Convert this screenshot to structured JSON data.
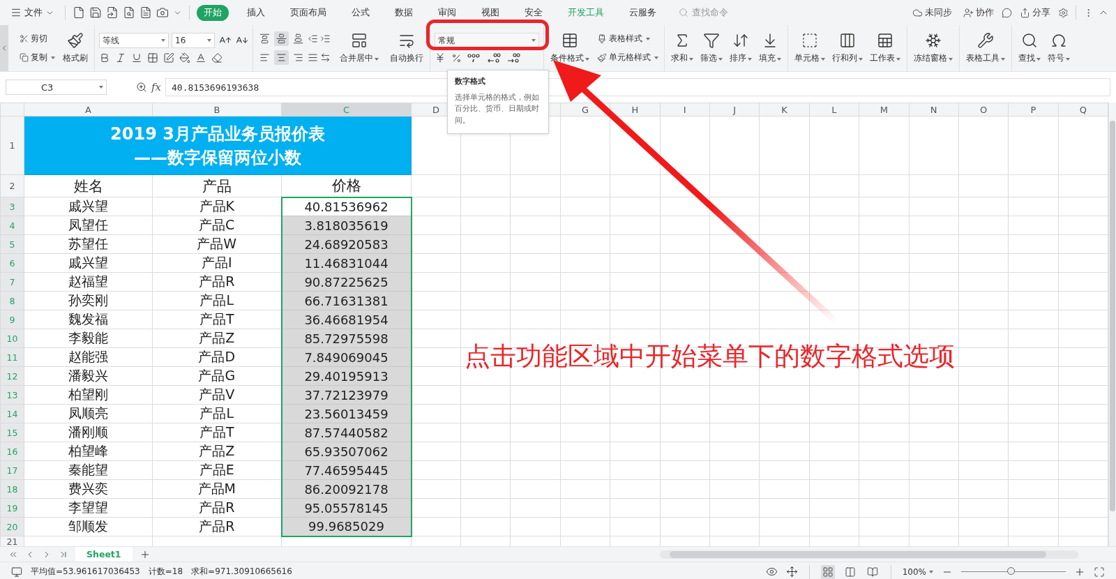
{
  "menu_bar": {
    "file_menu": "文件",
    "tabs": [
      {
        "label": "开始",
        "selected": true,
        "accent": false
      },
      {
        "label": "插入",
        "selected": false,
        "accent": false
      },
      {
        "label": "页面布局",
        "selected": false,
        "accent": false
      },
      {
        "label": "公式",
        "selected": false,
        "accent": false
      },
      {
        "label": "数据",
        "selected": false,
        "accent": false
      },
      {
        "label": "审阅",
        "selected": false,
        "accent": false
      },
      {
        "label": "视图",
        "selected": false,
        "accent": false
      },
      {
        "label": "安全",
        "selected": false,
        "accent": false
      },
      {
        "label": "开发工具",
        "selected": false,
        "accent": true
      },
      {
        "label": "云服务",
        "selected": false,
        "accent": false
      }
    ],
    "search": {
      "placeholder": "查找命令"
    },
    "actions": [
      {
        "kind": "sync",
        "label": "未同步"
      },
      {
        "kind": "collab",
        "label": "协作"
      },
      {
        "kind": "chat"
      },
      {
        "kind": "share",
        "label": "分享"
      },
      {
        "kind": "settings"
      }
    ]
  },
  "ribbon": {
    "clipboard": {
      "cut": "剪切",
      "copy": "复制",
      "painter": "格式刷"
    },
    "font": {
      "name": "等线",
      "size": "16"
    },
    "vertical_align": [
      {
        "selected": false
      },
      {
        "selected": true
      },
      {
        "selected": false
      }
    ],
    "horizontal_align": [
      {
        "selected": false
      },
      {
        "selected": true
      },
      {
        "selected": false
      }
    ],
    "merge": "合并居中",
    "wrap": "自动换行",
    "number": {
      "format": "常规"
    },
    "conditional": "条件格式",
    "table_style": "表格样式",
    "cell_style": "单元格样式",
    "groups": [
      [
        {
          "kind": "sum",
          "label": "求和"
        },
        {
          "kind": "filter",
          "label": "筛选"
        },
        {
          "kind": "sort",
          "label": "排序"
        },
        {
          "kind": "fill",
          "label": "填充"
        }
      ],
      [
        {
          "kind": "cell",
          "label": "单元格"
        },
        {
          "kind": "rowcol",
          "label": "行和列"
        },
        {
          "kind": "sheet",
          "label": "工作表"
        }
      ],
      [
        {
          "kind": "freeze",
          "label": "冻结窗格"
        }
      ],
      [
        {
          "kind": "tools",
          "label": "表格工具"
        }
      ],
      [
        {
          "kind": "find",
          "label": "查找"
        },
        {
          "kind": "symbol",
          "label": "符号"
        }
      ]
    ]
  },
  "tooltip": {
    "title": "数字格式",
    "body": "选择单元格的格式，例如百分比、货币、日期或时间。"
  },
  "formula_bar": {
    "cell_ref": "C3",
    "fx_label": "fx",
    "value": "40.8153696193638"
  },
  "sheet": {
    "columns": [
      {
        "label": "A",
        "selected": false
      },
      {
        "label": "B",
        "selected": false
      },
      {
        "label": "C",
        "selected": true
      },
      {
        "label": "D",
        "selected": false
      },
      {
        "label": "G",
        "selected": false
      },
      {
        "label": "H",
        "selected": false
      },
      {
        "label": "I",
        "selected": false
      },
      {
        "label": "J",
        "selected": false
      },
      {
        "label": "K",
        "selected": false
      },
      {
        "label": "L",
        "selected": false
      },
      {
        "label": "M",
        "selected": false
      },
      {
        "label": "N",
        "selected": false
      },
      {
        "label": "O",
        "selected": false
      },
      {
        "label": "P",
        "selected": false
      },
      {
        "label": "Q",
        "selected": false
      }
    ],
    "title_row": {
      "row": "1",
      "lines": [
        "2019 3月产品业务员报价表",
        "——数字保留两位小数"
      ]
    },
    "header_row": {
      "row": "2",
      "cells": [
        "姓名",
        "产品",
        "价格"
      ]
    },
    "rows": [
      {
        "row": "3",
        "name": "戚兴望",
        "product": "产品K",
        "price": "40.81536962",
        "selected": true,
        "active": true
      },
      {
        "row": "4",
        "name": "凤望任",
        "product": "产品C",
        "price": "3.818035619",
        "selected": true,
        "active": false
      },
      {
        "row": "5",
        "name": "苏望任",
        "product": "产品W",
        "price": "24.68920583",
        "selected": true,
        "active": false
      },
      {
        "row": "6",
        "name": "戚兴望",
        "product": "产品I",
        "price": "11.46831044",
        "selected": true,
        "active": false
      },
      {
        "row": "7",
        "name": "赵福望",
        "product": "产品R",
        "price": "90.87225625",
        "selected": true,
        "active": false
      },
      {
        "row": "8",
        "name": "孙奕刚",
        "product": "产品L",
        "price": "66.71631381",
        "selected": true,
        "active": false
      },
      {
        "row": "9",
        "name": "魏发福",
        "product": "产品T",
        "price": "36.46681954",
        "selected": true,
        "active": false
      },
      {
        "row": "10",
        "name": "李毅能",
        "product": "产品Z",
        "price": "85.72975598",
        "selected": true,
        "active": false
      },
      {
        "row": "11",
        "name": "赵能强",
        "product": "产品D",
        "price": "7.849069045",
        "selected": true,
        "active": false
      },
      {
        "row": "12",
        "name": "潘毅兴",
        "product": "产品G",
        "price": "29.40195913",
        "selected": true,
        "active": false
      },
      {
        "row": "13",
        "name": "柏望刚",
        "product": "产品V",
        "price": "37.72123979",
        "selected": true,
        "active": false
      },
      {
        "row": "14",
        "name": "凤顺亮",
        "product": "产品L",
        "price": "23.56013459",
        "selected": true,
        "active": false
      },
      {
        "row": "15",
        "name": "潘刚顺",
        "product": "产品T",
        "price": "87.57440582",
        "selected": true,
        "active": false
      },
      {
        "row": "16",
        "name": "柏望峰",
        "product": "产品Z",
        "price": "65.93507062",
        "selected": true,
        "active": false
      },
      {
        "row": "17",
        "name": "秦能望",
        "product": "产品E",
        "price": "77.46595445",
        "selected": true,
        "active": false
      },
      {
        "row": "18",
        "name": "费兴奕",
        "product": "产品M",
        "price": "86.20092178",
        "selected": true,
        "active": false
      },
      {
        "row": "19",
        "name": "李望望",
        "product": "产品R",
        "price": "95.05578145",
        "selected": true,
        "active": false
      },
      {
        "row": "20",
        "name": "邹顺发",
        "product": "产品R",
        "price": "99.9685029",
        "selected": true,
        "active": false
      }
    ],
    "tail_rows": [
      "21"
    ]
  },
  "sheet_tabs": [
    {
      "label": "Sheet1",
      "selected": true
    }
  ],
  "status_bar": {
    "stats": [
      "平均值=53.961617036453",
      "计数=18",
      "求和=971.30910665616"
    ],
    "view_modes": [
      {
        "kind": "normal",
        "selected": true
      },
      {
        "kind": "page",
        "selected": false
      },
      {
        "kind": "break",
        "selected": false
      }
    ],
    "zoom": "100%",
    "zoom_slider": {
      "level": 0.48
    }
  },
  "annotation": {
    "text": "点击功能区域中开始菜单下的数字格式选项"
  }
}
